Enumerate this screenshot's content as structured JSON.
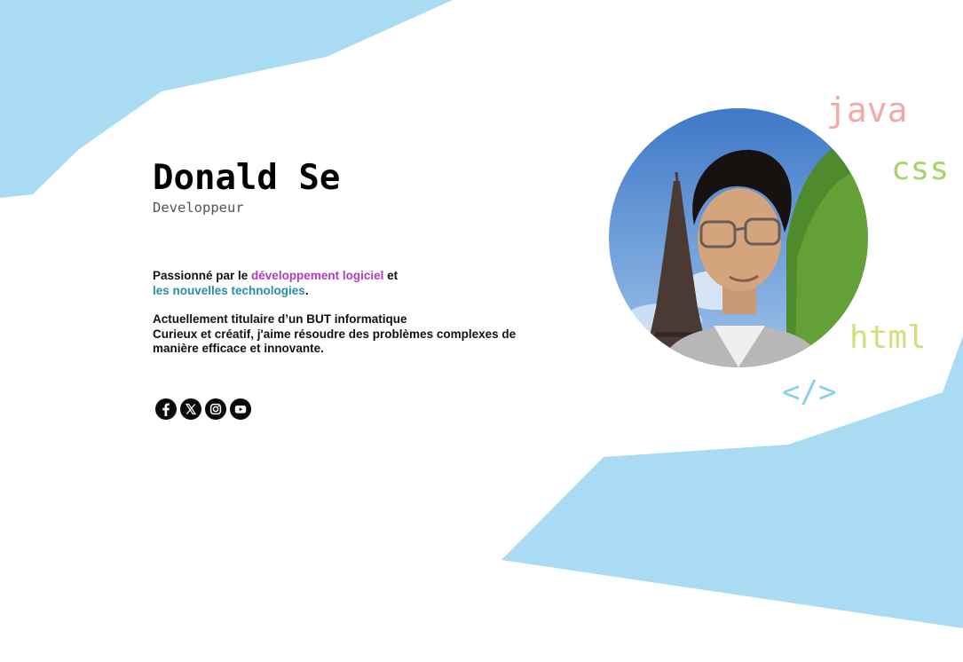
{
  "profile": {
    "name": "Donald Se",
    "role": "Developpeur"
  },
  "bio": {
    "line1_prefix": "Passionné par le ",
    "highlight1": "développement logiciel",
    "line1_suffix": " et",
    "highlight2": "les nouvelles technologies",
    "line2_suffix": ".",
    "paragraph2_line1": "Actuellement titulaire d’un BUT informatique",
    "paragraph2_line2": "Curieux et créatif, j'aime résoudre des problèmes complexes de manière efficace et innovante."
  },
  "socials": [
    {
      "network": "Facebook",
      "icon": "facebook-icon"
    },
    {
      "network": "X",
      "icon": "x-icon"
    },
    {
      "network": "Instagram",
      "icon": "instagram-icon"
    },
    {
      "network": "YouTube",
      "icon": "youtube-icon"
    }
  ],
  "code_words": {
    "java": "java",
    "css": "css",
    "html": "html",
    "tag": "</>"
  },
  "colors": {
    "background_shape": "#a9dcf3",
    "highlight_purple": "#b13cc3",
    "highlight_teal": "#2a8ea8",
    "java": "#f2a9a9",
    "css": "#a7d46a",
    "html": "#cfe07f",
    "tag": "#86d0ea"
  }
}
